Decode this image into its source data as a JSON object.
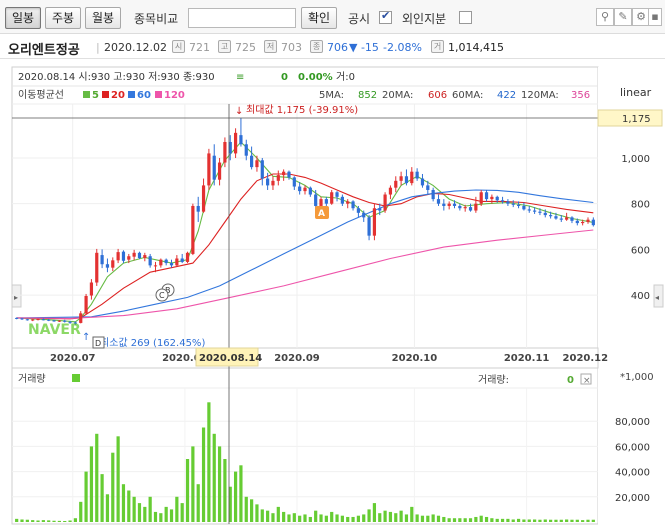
{
  "toolbar": {
    "tabs": [
      {
        "label": "일봉",
        "active": true
      },
      {
        "label": "주봉",
        "active": false
      },
      {
        "label": "월봉",
        "active": false
      }
    ],
    "compare_label": "종목비교",
    "search_value": "",
    "confirm_label": "확인",
    "disclosure_label": "공시",
    "disclosure_checked": true,
    "foreign_label": "외인지분",
    "foreign_checked": false
  },
  "stock": {
    "name": "오리엔트정공",
    "date": "2020.12.02",
    "open_icon": "시",
    "open": "721",
    "high_icon": "고",
    "high": "725",
    "low_icon": "저",
    "low": "703",
    "close_icon": "종",
    "close": "706",
    "change": "▼ -15",
    "change_pct": "-2.08%",
    "volume_icon": "거",
    "volume": "1,014,415"
  },
  "chart_header": {
    "ohlc_line": "2020.08.14 시:930 고:930 저:930 종:930",
    "eq": "≡",
    "chg": "0",
    "chg_pct": "0.00%",
    "vol": "거:0",
    "ma_title": "이동평균선",
    "ma_legend": [
      {
        "label": "5",
        "color": "#66bb44"
      },
      {
        "label": "20",
        "color": "#dd2222"
      },
      {
        "label": "60",
        "color": "#3377dd"
      },
      {
        "label": "120",
        "color": "#ee55aa"
      }
    ],
    "ma_values": [
      {
        "name": "5MA:",
        "value": "852",
        "color": "#339922"
      },
      {
        "name": "20MA:",
        "value": "606",
        "color": "#cc2222"
      },
      {
        "name": "60MA:",
        "value": "422",
        "color": "#2266cc"
      },
      {
        "name": "120MA:",
        "value": "356",
        "color": "#dd4499"
      }
    ],
    "scale": "linear",
    "cursor_price": "1,175",
    "max_label": "최대값 1,175 (-39.91%)",
    "min_label": "최소값 269 (162.45%)",
    "marker_a": "A",
    "marker_b": "B",
    "marker_c": "C",
    "marker_d": "D",
    "watermark": "NAVER"
  },
  "volume_header": {
    "title": "거래량",
    "right_label": "거래량:",
    "right_value": "0",
    "close_icon": "×",
    "unit": "*1,000"
  },
  "x_axis": {
    "labels": [
      "2020.07",
      "2020.08",
      "2020.09",
      "2020.10",
      "2020.11",
      "2020.12"
    ],
    "cursor_date": "2020.08.14"
  },
  "colors": {
    "up": "#e33131",
    "down": "#2e6fd6",
    "volume": "#66cc33"
  },
  "chart_data": {
    "type": "candlestick",
    "ylim": [
      269,
      1175
    ],
    "y_ticks": [
      400,
      600,
      800,
      1000
    ],
    "y_tick_labels": [
      "400",
      "600",
      "800",
      "1,000"
    ],
    "volume_ticks": [
      20000,
      40000,
      60000,
      80000
    ],
    "volume_tick_labels": [
      "20,000",
      "40,000",
      "60,000",
      "80,000"
    ],
    "candles": [
      [
        300,
        302,
        294,
        297,
        2500
      ],
      [
        298,
        300,
        291,
        294,
        2000
      ],
      [
        294,
        296,
        288,
        291,
        1800
      ],
      [
        290,
        295,
        286,
        293,
        1500
      ],
      [
        293,
        297,
        289,
        295,
        1200
      ],
      [
        294,
        298,
        289,
        292,
        1500
      ],
      [
        292,
        295,
        286,
        289,
        1300
      ],
      [
        289,
        292,
        283,
        286,
        1000
      ],
      [
        286,
        290,
        282,
        288,
        900
      ],
      [
        288,
        292,
        280,
        283,
        800
      ],
      [
        283,
        287,
        274,
        280,
        1200
      ],
      [
        280,
        284,
        269,
        278,
        3000
      ],
      [
        278,
        330,
        276,
        320,
        16000
      ],
      [
        320,
        405,
        316,
        396,
        40000
      ],
      [
        398,
        470,
        380,
        455,
        60000
      ],
      [
        455,
        602,
        440,
        585,
        70000
      ],
      [
        575,
        600,
        518,
        535,
        38000
      ],
      [
        535,
        560,
        500,
        520,
        22000
      ],
      [
        520,
        565,
        505,
        552,
        55000
      ],
      [
        552,
        602,
        540,
        588,
        68000
      ],
      [
        590,
        596,
        540,
        550,
        30000
      ],
      [
        555,
        580,
        540,
        570,
        25000
      ],
      [
        568,
        598,
        552,
        585,
        20000
      ],
      [
        585,
        590,
        558,
        562,
        15000
      ],
      [
        562,
        585,
        548,
        575,
        12000
      ],
      [
        570,
        580,
        520,
        530,
        20000
      ],
      [
        530,
        545,
        500,
        530,
        8000
      ],
      [
        530,
        560,
        520,
        555,
        7000
      ],
      [
        555,
        560,
        530,
        540,
        12000
      ],
      [
        540,
        555,
        520,
        530,
        10000
      ],
      [
        530,
        575,
        525,
        560,
        20000
      ],
      [
        560,
        580,
        540,
        545,
        15000
      ],
      [
        545,
        590,
        540,
        585,
        50000
      ],
      [
        580,
        800,
        575,
        790,
        60000
      ],
      [
        790,
        830,
        720,
        765,
        30000
      ],
      [
        765,
        910,
        760,
        880,
        75000
      ],
      [
        880,
        1040,
        860,
        1020,
        95000
      ],
      [
        1010,
        1060,
        880,
        905,
        70000
      ],
      [
        905,
        1000,
        880,
        980,
        60000
      ],
      [
        980,
        1090,
        960,
        1070,
        50000
      ],
      [
        1070,
        1100,
        990,
        1020,
        28000
      ],
      [
        1020,
        1130,
        1000,
        1110,
        40000
      ],
      [
        1100,
        1175,
        1050,
        1060,
        45000
      ],
      [
        1060,
        1080,
        990,
        1010,
        20000
      ],
      [
        1010,
        1050,
        950,
        960,
        18000
      ],
      [
        960,
        1010,
        940,
        990,
        14000
      ],
      [
        990,
        1000,
        880,
        910,
        10000
      ],
      [
        910,
        935,
        860,
        880,
        9000
      ],
      [
        880,
        920,
        860,
        900,
        7000
      ],
      [
        900,
        945,
        880,
        925,
        12000
      ],
      [
        925,
        950,
        900,
        940,
        8000
      ],
      [
        940,
        945,
        905,
        915,
        6000
      ],
      [
        915,
        920,
        860,
        875,
        7000
      ],
      [
        875,
        895,
        840,
        855,
        5000
      ],
      [
        855,
        880,
        840,
        870,
        6000
      ],
      [
        870,
        875,
        830,
        840,
        4000
      ],
      [
        840,
        860,
        780,
        790,
        9000
      ],
      [
        790,
        830,
        780,
        820,
        6000
      ],
      [
        820,
        830,
        790,
        800,
        5000
      ],
      [
        800,
        860,
        795,
        850,
        8000
      ],
      [
        850,
        855,
        810,
        830,
        6000
      ],
      [
        830,
        840,
        790,
        800,
        5000
      ],
      [
        800,
        820,
        780,
        810,
        4000
      ],
      [
        810,
        815,
        770,
        780,
        4000
      ],
      [
        780,
        790,
        740,
        760,
        5000
      ],
      [
        760,
        770,
        720,
        740,
        6000
      ],
      [
        740,
        750,
        640,
        660,
        10000
      ],
      [
        660,
        800,
        640,
        780,
        15000
      ],
      [
        780,
        800,
        750,
        770,
        7000
      ],
      [
        770,
        850,
        760,
        840,
        9000
      ],
      [
        840,
        880,
        820,
        870,
        8000
      ],
      [
        870,
        920,
        850,
        900,
        7000
      ],
      [
        900,
        940,
        880,
        920,
        9000
      ],
      [
        920,
        950,
        880,
        890,
        6000
      ],
      [
        890,
        960,
        880,
        940,
        12000
      ],
      [
        940,
        955,
        900,
        910,
        6000
      ],
      [
        910,
        930,
        870,
        880,
        5000
      ],
      [
        880,
        900,
        840,
        860,
        5000
      ],
      [
        860,
        870,
        810,
        820,
        6000
      ],
      [
        820,
        840,
        790,
        800,
        5000
      ],
      [
        800,
        820,
        770,
        790,
        4000
      ],
      [
        790,
        810,
        775,
        800,
        3000
      ],
      [
        800,
        815,
        780,
        790,
        3000
      ],
      [
        790,
        800,
        770,
        780,
        3000
      ],
      [
        780,
        795,
        765,
        785,
        3000
      ],
      [
        785,
        800,
        765,
        770,
        3000
      ],
      [
        770,
        830,
        760,
        800,
        4000
      ],
      [
        800,
        860,
        790,
        850,
        5000
      ],
      [
        850,
        860,
        810,
        820,
        4000
      ],
      [
        820,
        840,
        800,
        830,
        3000
      ],
      [
        830,
        835,
        805,
        815,
        2500
      ],
      [
        815,
        830,
        800,
        810,
        2500
      ],
      [
        810,
        820,
        790,
        800,
        2500
      ],
      [
        800,
        815,
        785,
        795,
        2000
      ],
      [
        795,
        810,
        780,
        790,
        2500
      ],
      [
        790,
        805,
        770,
        775,
        2000
      ],
      [
        775,
        790,
        760,
        770,
        2000
      ],
      [
        770,
        785,
        755,
        765,
        2000
      ],
      [
        765,
        780,
        750,
        760,
        1800
      ],
      [
        760,
        775,
        740,
        750,
        2000
      ],
      [
        750,
        765,
        735,
        745,
        1800
      ],
      [
        745,
        760,
        730,
        735,
        1800
      ],
      [
        735,
        750,
        720,
        730,
        1800
      ],
      [
        730,
        760,
        725,
        740,
        2000
      ],
      [
        740,
        745,
        715,
        725,
        1800
      ],
      [
        725,
        735,
        705,
        715,
        1800
      ],
      [
        715,
        730,
        705,
        720,
        1500
      ],
      [
        720,
        740,
        712,
        730,
        1800
      ],
      [
        730,
        740,
        700,
        706,
        1800
      ]
    ],
    "ma_lines": {
      "ma5": [
        [
          0,
          300
        ],
        [
          6,
          292
        ],
        [
          11,
          283
        ],
        [
          12,
          300
        ],
        [
          14,
          360
        ],
        [
          17,
          480
        ],
        [
          20,
          540
        ],
        [
          24,
          565
        ],
        [
          29,
          540
        ],
        [
          32,
          555
        ],
        [
          34,
          680
        ],
        [
          36,
          860
        ],
        [
          39,
          990
        ],
        [
          42,
          1070
        ],
        [
          45,
          1000
        ],
        [
          48,
          920
        ],
        [
          51,
          915
        ],
        [
          54,
          880
        ],
        [
          57,
          830
        ],
        [
          60,
          825
        ],
        [
          63,
          800
        ],
        [
          66,
          740
        ],
        [
          69,
          770
        ],
        [
          72,
          880
        ],
        [
          75,
          920
        ],
        [
          78,
          880
        ],
        [
          81,
          820
        ],
        [
          84,
          790
        ],
        [
          88,
          800
        ],
        [
          92,
          805
        ],
        [
          96,
          790
        ],
        [
          100,
          760
        ],
        [
          104,
          735
        ],
        [
          108,
          718
        ]
      ],
      "ma20": [
        [
          0,
          300
        ],
        [
          10,
          296
        ],
        [
          12,
          300
        ],
        [
          16,
          360
        ],
        [
          20,
          430
        ],
        [
          25,
          500
        ],
        [
          29,
          520
        ],
        [
          33,
          540
        ],
        [
          36,
          620
        ],
        [
          39,
          720
        ],
        [
          42,
          820
        ],
        [
          45,
          900
        ],
        [
          48,
          930
        ],
        [
          51,
          930
        ],
        [
          54,
          915
        ],
        [
          57,
          890
        ],
        [
          60,
          860
        ],
        [
          63,
          830
        ],
        [
          66,
          805
        ],
        [
          69,
          790
        ],
        [
          72,
          800
        ],
        [
          75,
          830
        ],
        [
          78,
          845
        ],
        [
          81,
          840
        ],
        [
          84,
          825
        ],
        [
          87,
          810
        ],
        [
          91,
          810
        ],
        [
          95,
          805
        ],
        [
          99,
          790
        ],
        [
          103,
          775
        ],
        [
          108,
          760
        ]
      ],
      "ma60": [
        [
          0,
          300
        ],
        [
          10,
          303
        ],
        [
          14,
          305
        ],
        [
          20,
          330
        ],
        [
          26,
          360
        ],
        [
          32,
          390
        ],
        [
          38,
          440
        ],
        [
          44,
          510
        ],
        [
          50,
          580
        ],
        [
          56,
          650
        ],
        [
          62,
          720
        ],
        [
          66,
          760
        ],
        [
          70,
          800
        ],
        [
          74,
          830
        ],
        [
          78,
          845
        ],
        [
          82,
          855
        ],
        [
          86,
          860
        ],
        [
          90,
          858
        ],
        [
          94,
          850
        ],
        [
          98,
          835
        ],
        [
          102,
          822
        ],
        [
          108,
          805
        ]
      ],
      "ma120": [
        [
          0,
          300
        ],
        [
          10,
          298
        ],
        [
          20,
          310
        ],
        [
          30,
          340
        ],
        [
          40,
          390
        ],
        [
          50,
          440
        ],
        [
          60,
          500
        ],
        [
          70,
          560
        ],
        [
          80,
          610
        ],
        [
          90,
          640
        ],
        [
          100,
          665
        ],
        [
          108,
          685
        ]
      ]
    }
  }
}
